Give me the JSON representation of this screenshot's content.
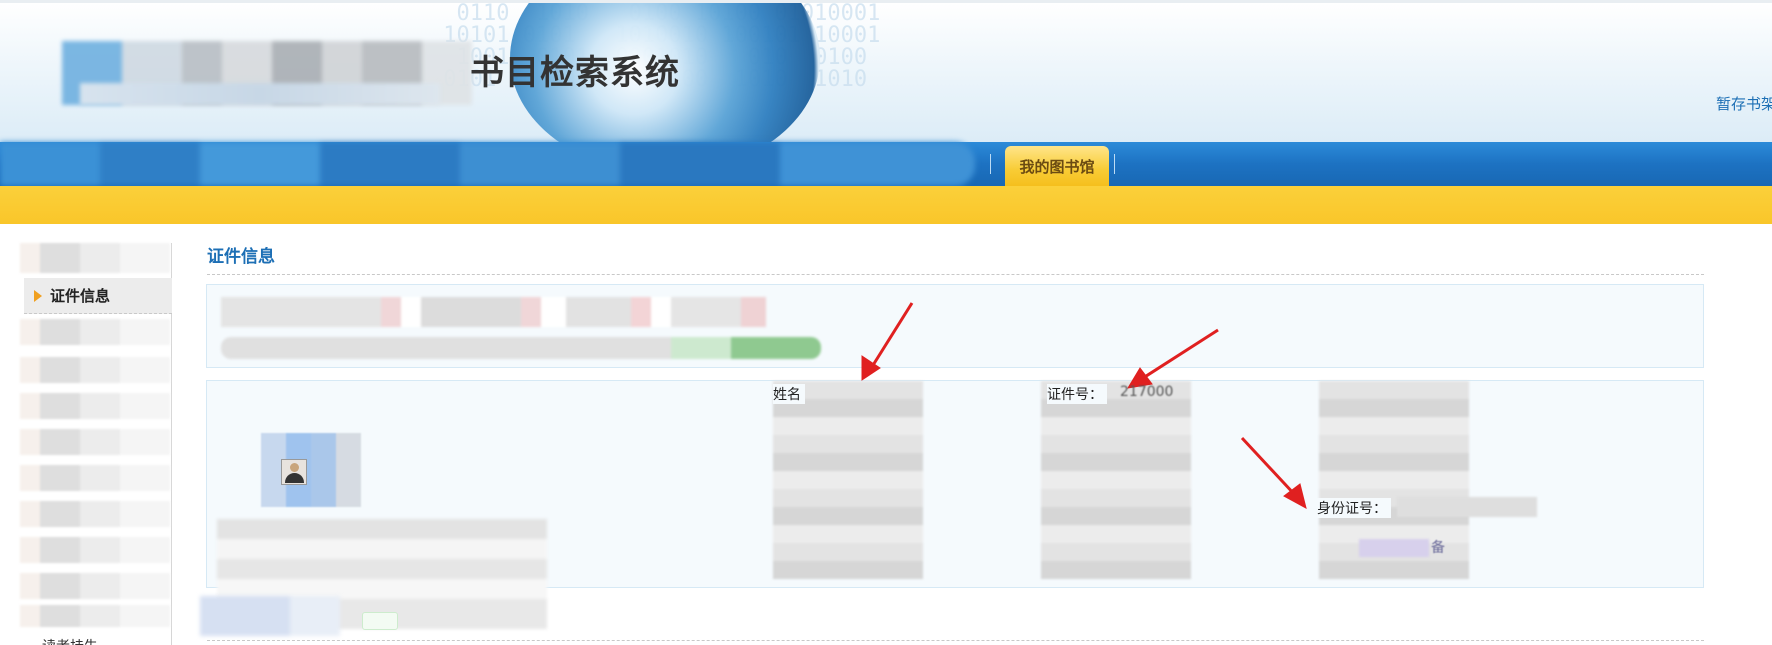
{
  "header": {
    "site_title": "书目检索系统",
    "temp_shelf_link": "暂存书架"
  },
  "nav": {
    "my_library_tab": "我的图书馆"
  },
  "sidebar": {
    "active_item": "证件信息",
    "bottom_item": "读者挂失"
  },
  "main": {
    "section_title": "证件信息",
    "fields": {
      "name_label": "姓名",
      "card_no_label": "证件号：",
      "card_no_value": "217000",
      "id_no_label": "身份证号：",
      "note_text": "备"
    }
  },
  "colors": {
    "accent_blue": "#1d6fb5",
    "nav_blue": "#1d72c2",
    "yellow_bar": "#f9c62a",
    "annotation_red": "#e02020"
  }
}
